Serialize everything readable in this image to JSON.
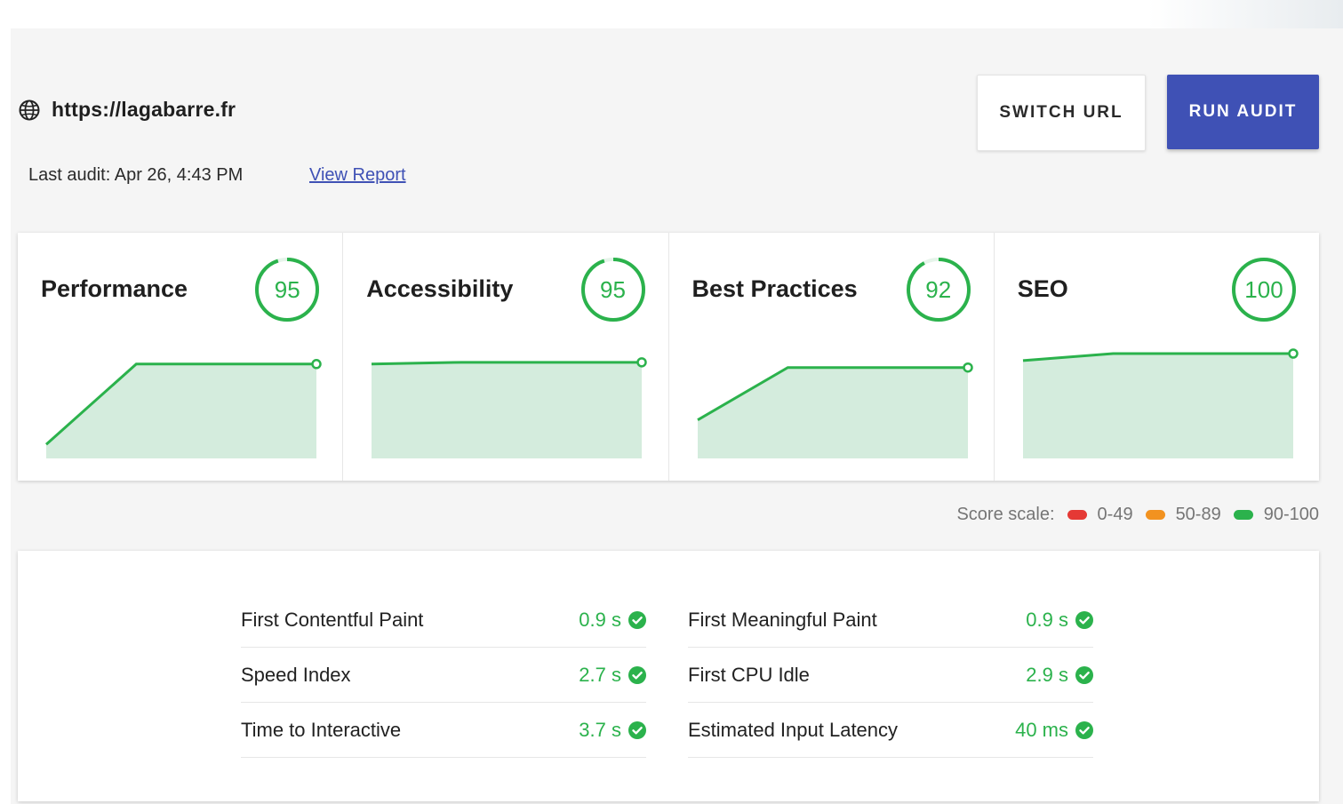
{
  "header": {
    "url": "https://lagabarre.fr",
    "last_audit": "Last audit: Apr 26, 4:43 PM",
    "view_report": "View Report",
    "switch_url": "SWITCH URL",
    "run_audit": "RUN AUDIT"
  },
  "colors": {
    "accent": "#3f51b5",
    "pass": "#2bb24c",
    "pass_fill": "#d4ecdd",
    "average": "#f29220",
    "fail": "#e53935"
  },
  "scores": [
    {
      "label": "Performance",
      "score": 95,
      "history": [
        48,
        94,
        94,
        94
      ]
    },
    {
      "label": "Accessibility",
      "score": 95,
      "history": [
        94,
        95,
        95,
        95
      ]
    },
    {
      "label": "Best Practices",
      "score": 92,
      "history": [
        62,
        92,
        92,
        92
      ]
    },
    {
      "label": "SEO",
      "score": 100,
      "history": [
        96,
        100,
        100,
        100
      ]
    }
  ],
  "legend": {
    "title": "Score scale:",
    "ranges": [
      {
        "label": "0-49",
        "color": "#e53935"
      },
      {
        "label": "50-89",
        "color": "#f29220"
      },
      {
        "label": "90-100",
        "color": "#2bb24c"
      }
    ]
  },
  "metrics": {
    "left": [
      {
        "name": "First Contentful Paint",
        "value": "0.9 s"
      },
      {
        "name": "Speed Index",
        "value": "2.7 s"
      },
      {
        "name": "Time to Interactive",
        "value": "3.7 s"
      }
    ],
    "right": [
      {
        "name": "First Meaningful Paint",
        "value": "0.9 s"
      },
      {
        "name": "First CPU Idle",
        "value": "2.9 s"
      },
      {
        "name": "Estimated Input Latency",
        "value": "40 ms"
      }
    ]
  }
}
